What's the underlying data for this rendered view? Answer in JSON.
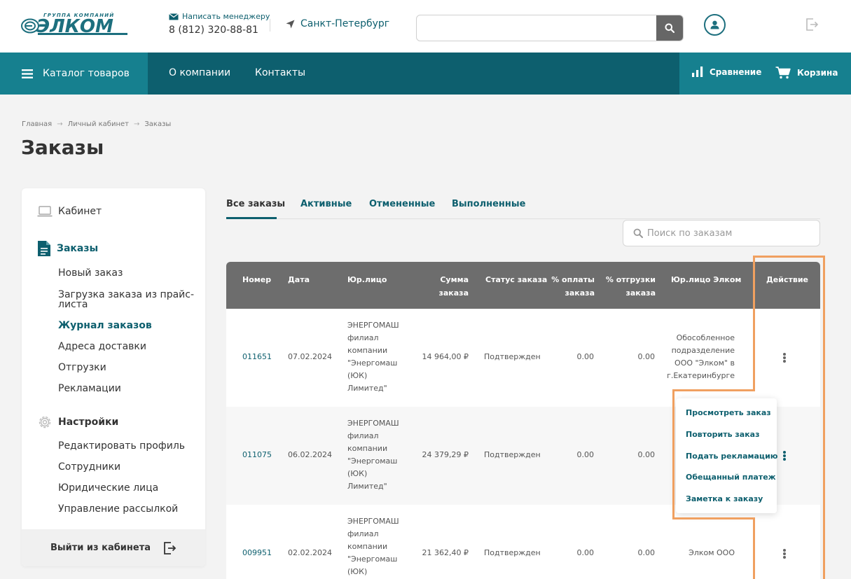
{
  "header": {
    "logo_top": "ГРУППА КОМПАНИЙ",
    "logo_word": "ЭЛКОМ",
    "manager_link": "Написать менеджеру",
    "phone": "8 (812) 320-88-81",
    "city": "Санкт-Петербург",
    "search_value": ""
  },
  "nav": {
    "catalog": "Каталог товаров",
    "about": "О компании",
    "contacts": "Контакты",
    "compare": "Сравнение",
    "cart": "Корзина"
  },
  "breadcrumbs": [
    "Главная",
    "Личный кабинет",
    "Заказы"
  ],
  "page_title": "Заказы",
  "sidebar": {
    "cabinet": "Кабинет",
    "orders": "Заказы",
    "orders_items": [
      "Новый заказ",
      "Загрузка заказа из прайс-\nлиста",
      "Журнал заказов",
      "Адреса доставки",
      "Отгрузки",
      "Рекламации"
    ],
    "settings": "Настройки",
    "settings_items": [
      "Редактировать профиль",
      "Сотрудники",
      "Юридические лица",
      "Управление рассылкой"
    ],
    "logout": "Выйти из кабинета"
  },
  "tabs": [
    "Все заказы",
    "Активные",
    "Отмененные",
    "Выполненные"
  ],
  "active_tab": "Все заказы",
  "order_search_placeholder": "Поиск по заказам",
  "table": {
    "headers": {
      "number": "Номер",
      "date": "Дата",
      "entity": "Юр.лицо",
      "sum": "Сумма\nзаказа",
      "status": "Статус заказа",
      "paid": "% оплаты\nзаказа",
      "shipped": "% отгрузки\nзаказа",
      "elkom_entity": "Юр.лицо Элком",
      "action": "Действие"
    },
    "rows": [
      {
        "number": "011651",
        "date": "07.02.2024",
        "entity": "ЭНЕРГОМАШ\nфилиал\nкомпании\n\"Энергомаш\n(ЮК)\nЛимитед\"",
        "sum": "14 964,00 ₽",
        "status": "Подтвержден",
        "paid": "0.00",
        "shipped": "0.00",
        "elkom_entity": "Обособленное\nподразделение\nООО \"Элком\" в\nг.Екатеринбурге"
      },
      {
        "number": "011075",
        "date": "06.02.2024",
        "entity": "ЭНЕРГОМАШ\nфилиал\nкомпании\n\"Энергомаш\n(ЮК)\nЛимитед\"",
        "sum": "24 379,29 ₽",
        "status": "Подтвержден",
        "paid": "0.00",
        "shipped": "0.00",
        "elkom_entity": ""
      },
      {
        "number": "009951",
        "date": "02.02.2024",
        "entity": "ЭНЕРГОМАШ\nфилиал\nкомпании\n\"Энергомаш\n(ЮК)",
        "sum": "21 362,40 ₽",
        "status": "Подтвержден",
        "paid": "0.00",
        "shipped": "0.00",
        "elkom_entity": "Элком ООО"
      }
    ]
  },
  "action_menu": [
    "Просмотреть заказ",
    "Повторить заказ",
    "Подать рекламацию",
    "Обещанный платеж",
    "Заметка к заказу"
  ],
  "colors": {
    "brand": "#0d5f6e",
    "nav_accent": "#16808f",
    "table_header": "#6d6d6d",
    "highlight": "#f0a060"
  }
}
